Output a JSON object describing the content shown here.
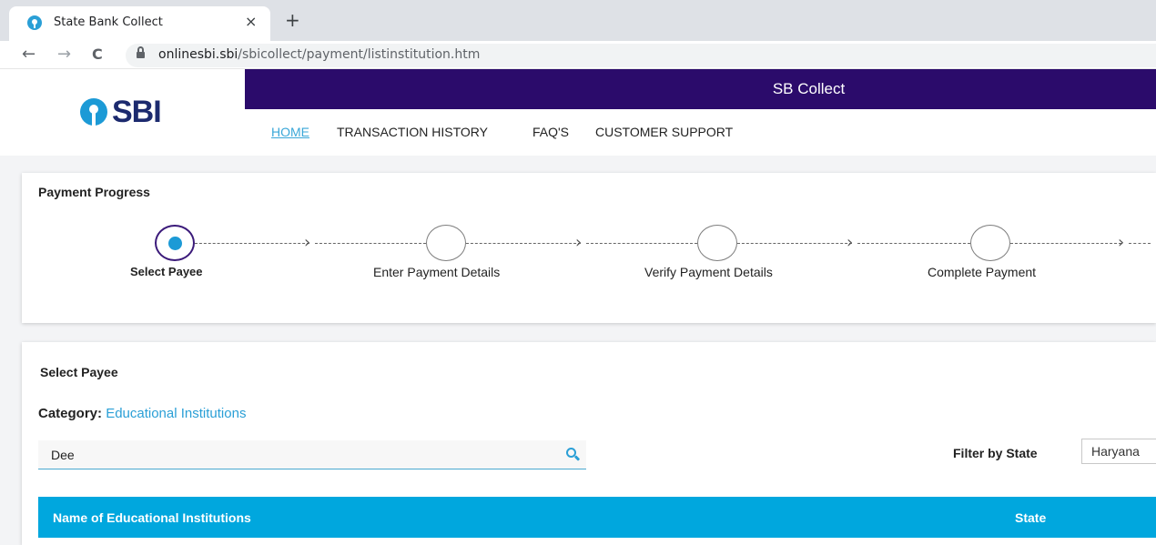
{
  "browser": {
    "tab_title": "State Bank Collect",
    "tab_close": "×",
    "new_tab": "+",
    "back": "←",
    "forward": "→",
    "reload": "C",
    "url_domain": "onlinesbi.sbi",
    "url_path": "/sbicollect/payment/listinstitution.htm"
  },
  "header": {
    "logo_text": "SBI",
    "app_title": "SB Collect",
    "nav": [
      "HOME",
      "TRANSACTION HISTORY",
      "FAQ'S",
      "CUSTOMER SUPPORT"
    ],
    "active_nav": "HOME"
  },
  "progress": {
    "title": "Payment Progress",
    "steps": [
      "Select Payee",
      "Enter Payment Details",
      "Verify Payment Details",
      "Complete Payment"
    ],
    "active_step": 0
  },
  "payee": {
    "title": "Select Payee",
    "category_label": "Category:",
    "category_value": "Educational Institutions",
    "search_value": "Dee",
    "filter_label": "Filter by State",
    "state_selected": "Haryana",
    "table_headers": [
      "Name of Educational Institutions",
      "State"
    ]
  },
  "colors": {
    "brand_purple": "#2b0b6b",
    "accent_blue": "#00a7de",
    "link_blue": "#2a9fd6"
  }
}
